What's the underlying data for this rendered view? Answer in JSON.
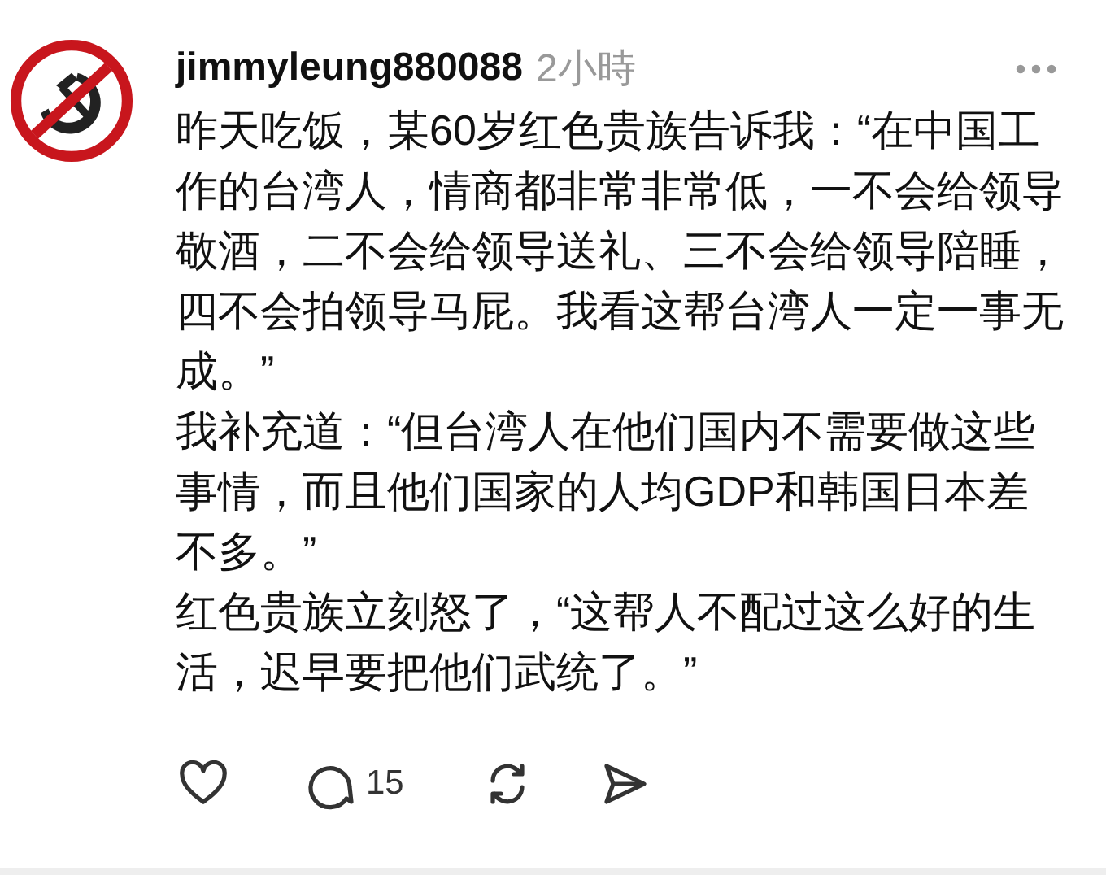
{
  "post": {
    "username": "jimmyleung880088",
    "time": "2小時",
    "paragraphs": [
      "昨天吃饭，某60岁红色贵族告诉我：“在中国工作的台湾人，情商都非常非常低，一不会给领导敬酒，二不会给领导送礼、三不会给领导陪睡，四不会拍领导马屁。我看这帮台湾人一定一事无成。”",
      "我补充道：“但台湾人在他们国内不需要做这些事情，而且他们国家的人均GDP和韩国日本差不多。”",
      "红色贵族立刻怒了，“这帮人不配过这么好的生活，迟早要把他们武统了。”"
    ],
    "comment_count": "15"
  }
}
